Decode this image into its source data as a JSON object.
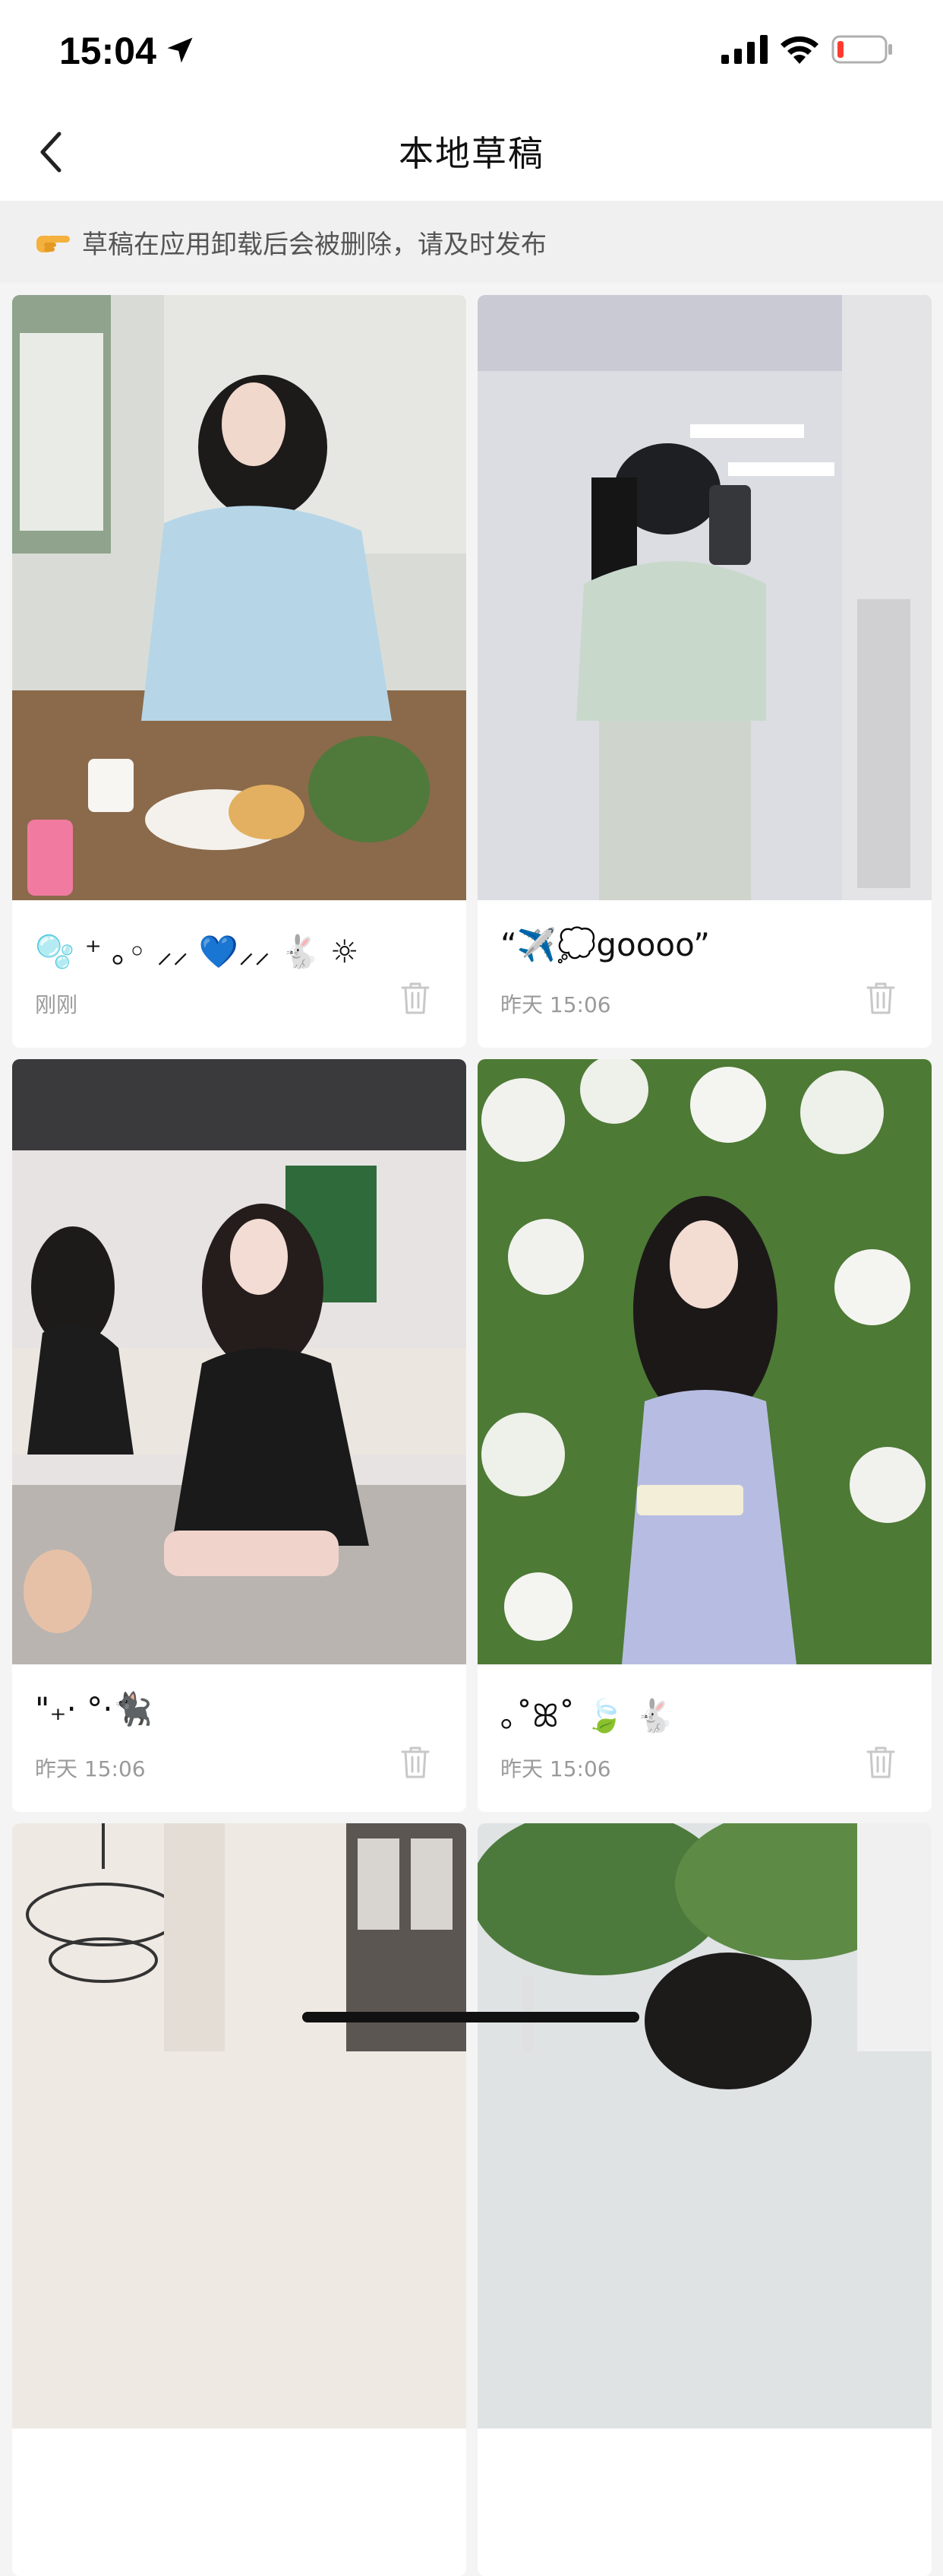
{
  "status_bar": {
    "time": "15:04"
  },
  "nav": {
    "title": "本地草稿"
  },
  "notice": {
    "icon": "pointing-hand-icon",
    "text": "草稿在应用卸载后会被删除，请及时发布"
  },
  "drafts": [
    {
      "title": "🫧 ⁺ ｡◦ ⸝⸝ 💙⸝⸝ 🐇 ☼",
      "time": "刚刚"
    },
    {
      "title": "“✈️💭goooo”",
      "time": "昨天 15:06"
    },
    {
      "title": "\"₊· °·🐈‍⬛",
      "time": "昨天 15:06"
    },
    {
      "title": "｡˚ꕤ˚ 🍃 🐇",
      "time": "昨天 15:06"
    },
    {
      "title": "",
      "time": ""
    },
    {
      "title": "",
      "time": ""
    }
  ],
  "colors": {
    "background": "#f4f4f4",
    "card": "#ffffff",
    "notice_bg": "#f0f0f0",
    "muted_text": "#9a9a9a"
  }
}
